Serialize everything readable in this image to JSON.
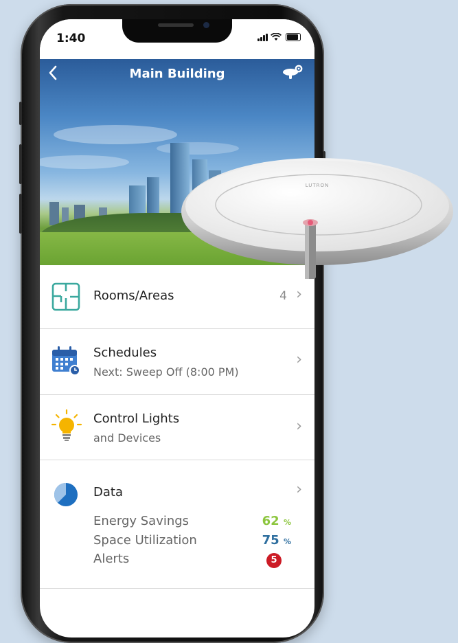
{
  "status_bar": {
    "time": "1:40"
  },
  "nav": {
    "title": "Main Building"
  },
  "menu": {
    "rooms": {
      "label": "Rooms/Areas",
      "count": "4"
    },
    "schedules": {
      "label": "Schedules",
      "subtitle": "Next: Sweep Off (8:00 PM)"
    },
    "lights": {
      "label": "Control Lights",
      "subtitle": "and Devices"
    },
    "data": {
      "label": "Data",
      "stats": [
        {
          "label": "Energy Savings",
          "value": "62",
          "unit": "%",
          "color": "#8dc63f"
        },
        {
          "label": "Space Utilization",
          "value": "75",
          "unit": "%",
          "color": "#2f6f9f"
        },
        {
          "label": "Alerts",
          "value": "5",
          "color": "#cc1b25"
        }
      ]
    }
  },
  "sensor": {
    "brand": "LUTRON"
  },
  "colors": {
    "background": "#cddceb",
    "accent_teal": "#3aa89e",
    "calendar_blue": "#3f7fd0",
    "bulb_yellow": "#f5b400",
    "chart_blue": "#1e6fc0"
  }
}
